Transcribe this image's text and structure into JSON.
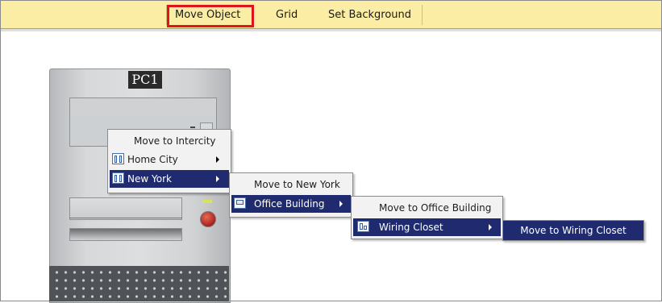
{
  "toolbar": {
    "move_object": "Move Object",
    "grid": "Grid",
    "set_background": "Set Background"
  },
  "device": {
    "label": "PC1"
  },
  "menu1": {
    "move": "Move to Intercity",
    "home_city": "Home City",
    "new_york": "New York"
  },
  "menu2": {
    "move": "Move to New York",
    "office_building": "Office Building"
  },
  "menu3": {
    "move": "Move to Office Building",
    "wiring_closet": "Wiring Closet"
  },
  "menu4": {
    "move": "Move to Wiring Closet"
  },
  "colors": {
    "toolbar_bg": "#fbeda4",
    "highlight": "#e0141c",
    "menu_selected": "#1f2b6e"
  }
}
